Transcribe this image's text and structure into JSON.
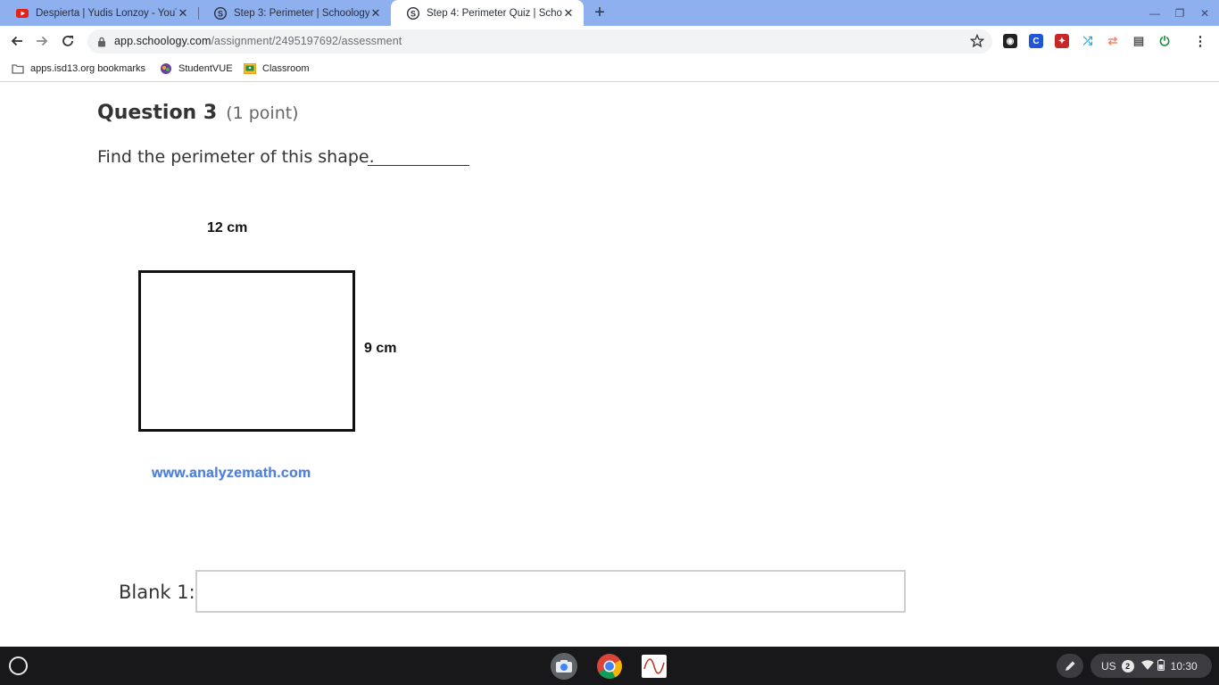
{
  "browser": {
    "tabs": [
      {
        "title": "Despierta | Yudis Lonzoy - YouTu",
        "favicon": "youtube-icon",
        "active": false
      },
      {
        "title": "Step 3: Perimeter | Schoology",
        "favicon": "schoology-icon",
        "active": false
      },
      {
        "title": "Step 4: Perimeter Quiz | Schoolo",
        "favicon": "schoology-icon",
        "active": true
      }
    ],
    "url_host": "app.schoology.com",
    "url_path": "/assignment/2495197692/assessment",
    "bookmarks": [
      {
        "label": "apps.isd13.org bookmarks",
        "icon": "folder-icon"
      },
      {
        "label": "StudentVUE",
        "icon": "studentvue-icon"
      },
      {
        "label": "Classroom",
        "icon": "classroom-icon"
      }
    ]
  },
  "question": {
    "title": "Question 3",
    "points": "(1 point)",
    "prompt": "Find the perimeter of this shape.",
    "figure": {
      "top_label": "12 cm",
      "side_label": "9 cm",
      "source": "www.analyzemath.com"
    },
    "blank_label": "Blank 1:",
    "blank_value": ""
  },
  "shelf": {
    "locale": "US",
    "notification_count": "2",
    "time": "10:30"
  },
  "colors": {
    "tabstrip": "#8fb0ef",
    "shelf": "#18181a",
    "link": "#4f7fd6"
  }
}
